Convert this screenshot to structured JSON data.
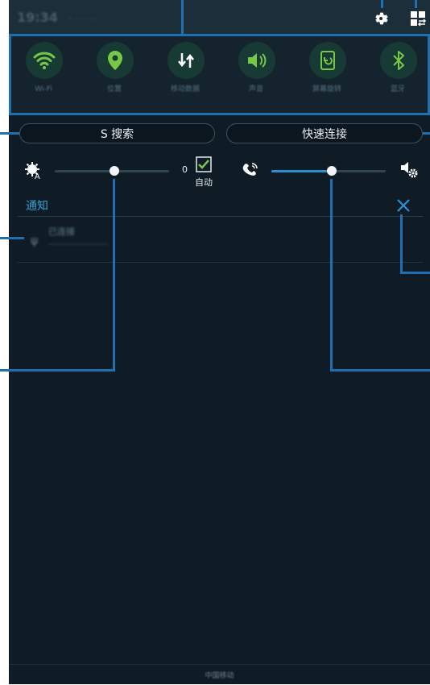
{
  "status_bar": {
    "time_text": "19:34",
    "info_text": "·· ··· ·····",
    "settings_icon": "gear-icon",
    "grid_icon": "grid-switch-icon"
  },
  "quick_settings": [
    {
      "id": "wifi",
      "icon": "wifi-icon",
      "label": "Wi-Fi"
    },
    {
      "id": "location",
      "icon": "location-icon",
      "label": "位置"
    },
    {
      "id": "data",
      "icon": "data-sync-icon",
      "label": "移动数据"
    },
    {
      "id": "sound",
      "icon": "volume-icon",
      "label": "声音"
    },
    {
      "id": "rotate",
      "icon": "screen-rotation-icon",
      "label": "屏幕旋转"
    },
    {
      "id": "bluetooth",
      "icon": "bluetooth-icon",
      "label": "蓝牙"
    }
  ],
  "buttons": {
    "s_search": "S 搜索",
    "quick_connect": "快速连接"
  },
  "brightness": {
    "value_label": "0",
    "auto_label": "自动",
    "auto_checked": true,
    "level": 0.52
  },
  "volume": {
    "level": 0.53
  },
  "notifications": {
    "title": "通知",
    "items": [
      {
        "title": "已连接",
        "subtitle": "··························"
      }
    ]
  },
  "footer": {
    "carrier_text": "中国移动"
  },
  "colors": {
    "accent_green": "#76c846",
    "accent_blue": "#2d8ed0",
    "panel_bg": "#0f1c26"
  }
}
